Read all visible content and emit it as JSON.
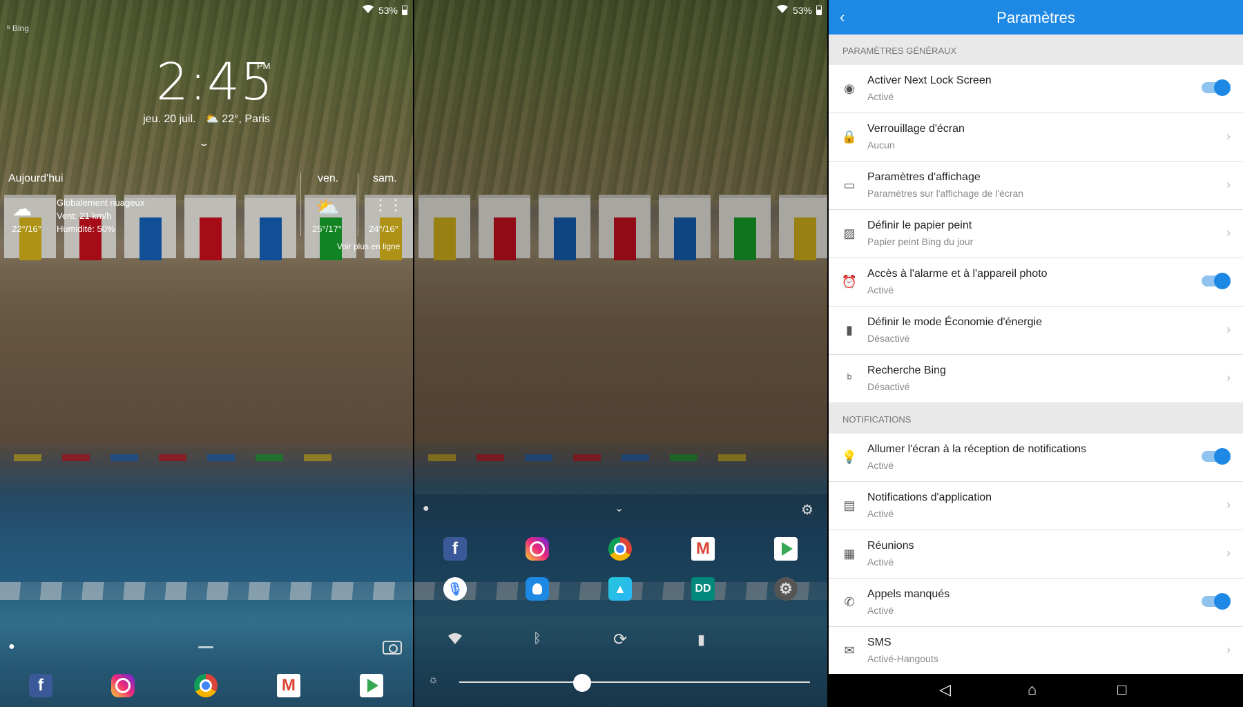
{
  "status": {
    "battery": "53%"
  },
  "lock": {
    "bing": "Bing",
    "time": "2:45",
    "ampm": "PM",
    "date": "jeu. 20 juil.",
    "weather_now": "22°, Paris",
    "today_label": "Aujourd'hui",
    "today_desc": [
      "Globalement nuageux",
      "Vent: 21 km/h",
      "Humidité: 50%"
    ],
    "today_temp": "22°/16°",
    "day2": "ven.",
    "day2_temp": "25°/17°",
    "day3": "sam.",
    "day3_temp": "24°/16°",
    "more": "Voir plus en ligne"
  },
  "icons": {
    "wifi": "wifi-icon",
    "battery": "battery-icon",
    "location": "location-pin-icon",
    "camera": "camera-icon",
    "gear": "gear-icon",
    "bluetooth": "bluetooth-icon",
    "rotate": "rotate-icon",
    "brightness": "brightness-icon",
    "back": "back-arrow-icon"
  },
  "dock_apps": [
    "Facebook",
    "Instagram",
    "Chrome",
    "Gmail",
    "Play Store"
  ],
  "shortcut_apps": [
    "Google Voice",
    "Contacts",
    "Galerie",
    "Dolby",
    "Paramètres"
  ],
  "brightness_level": 0.35,
  "settings": {
    "title": "Paramètres",
    "section_general": "PARAMÈTRES GÉNÉRAUX",
    "section_notifications": "NOTIFICATIONS",
    "general": [
      {
        "title": "Activer Next Lock Screen",
        "sub": "Activé",
        "toggle": true,
        "icon": "next-logo-icon"
      },
      {
        "title": "Verrouillage d'écran",
        "sub": "Aucun",
        "toggle": false,
        "icon": "lock-icon"
      },
      {
        "title": "Paramètres d'affichage",
        "sub": "Paramètres sur l'affichage de l'écran",
        "toggle": false,
        "icon": "display-icon"
      },
      {
        "title": "Définir le papier peint",
        "sub": "Papier peint Bing du jour",
        "toggle": false,
        "icon": "image-icon"
      },
      {
        "title": "Accès à l'alarme et à l'appareil photo",
        "sub": "Activé",
        "toggle": true,
        "icon": "alarm-icon"
      },
      {
        "title": "Définir le mode Économie d'énergie",
        "sub": "Désactivé",
        "toggle": false,
        "icon": "battery-saver-icon"
      },
      {
        "title": "Recherche Bing",
        "sub": "Désactivé",
        "toggle": false,
        "icon": "bing-icon"
      }
    ],
    "notifications": [
      {
        "title": "Allumer l'écran à la réception de notifications",
        "sub": "Activé",
        "toggle": true,
        "icon": "bulb-icon"
      },
      {
        "title": "Notifications d'application",
        "sub": "Activé",
        "toggle": false,
        "icon": "message-icon"
      },
      {
        "title": "Réunions",
        "sub": "Activé",
        "toggle": false,
        "icon": "calendar-icon"
      },
      {
        "title": "Appels manqués",
        "sub": "Activé",
        "toggle": true,
        "icon": "phone-icon"
      },
      {
        "title": "SMS",
        "sub": "Activé-Hangouts",
        "toggle": false,
        "icon": "mail-icon"
      }
    ]
  }
}
